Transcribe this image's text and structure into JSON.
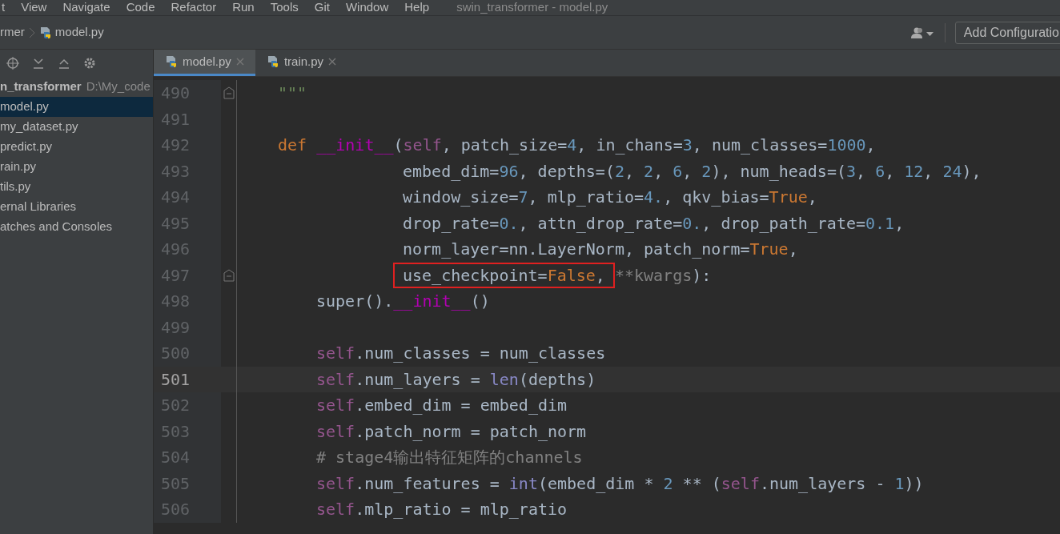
{
  "menu_bar": {
    "items": [
      "t",
      "View",
      "Navigate",
      "Code",
      "Refactor",
      "Run",
      "Tools",
      "Git",
      "Window",
      "Help"
    ],
    "title": "swin_transformer - model.py"
  },
  "nav_bar": {
    "breadcrumb": [
      "rmer",
      "model.py"
    ],
    "run_config": "Add Configuratio"
  },
  "tabs": [
    {
      "label": "model.py",
      "selected": true
    },
    {
      "label": "train.py",
      "selected": false
    }
  ],
  "project_tree": {
    "root": {
      "name": "n_transformer",
      "path": "D:\\My_code"
    },
    "items": [
      {
        "label": "model.py",
        "selected": true
      },
      {
        "label": "my_dataset.py",
        "selected": false
      },
      {
        "label": "predict.py",
        "selected": false
      },
      {
        "label": "rain.py",
        "selected": false
      },
      {
        "label": "tils.py",
        "selected": false
      },
      {
        "label": "ernal Libraries",
        "selected": false
      },
      {
        "label": "atches and Consoles",
        "selected": false
      }
    ]
  },
  "editor": {
    "lines": [
      {
        "number": "490",
        "current": false,
        "fold": true,
        "kind": "block",
        "tokens": [
          {
            "kind": "string",
            "text": "\"\"\""
          }
        ]
      },
      {
        "number": "491",
        "current": false,
        "fold": false
      },
      {
        "number": "492",
        "current": false,
        "fold": false,
        "kind": "block",
        "tokens": [
          {
            "kind": "keyword",
            "text": "def "
          },
          {
            "kind": "magic",
            "text": "__init__"
          },
          {
            "kind": "plain",
            "text": "("
          },
          {
            "kind": "self",
            "text": "self"
          },
          {
            "kind": "plain",
            "text": ", patch_size="
          },
          {
            "kind": "number",
            "text": "4"
          },
          {
            "kind": "plain",
            "text": ", in_chans="
          },
          {
            "kind": "number",
            "text": "3"
          },
          {
            "kind": "plain",
            "text": ", num_classes="
          },
          {
            "kind": "number",
            "text": "1000"
          },
          {
            "kind": "plain",
            "text": ","
          }
        ]
      },
      {
        "number": "493",
        "current": false,
        "fold": false,
        "kind": "continuation",
        "tokens": [
          {
            "kind": "plain",
            "text": "embed_dim="
          },
          {
            "kind": "number",
            "text": "96"
          },
          {
            "kind": "plain",
            "text": ", depths=("
          },
          {
            "kind": "number",
            "text": "2"
          },
          {
            "kind": "plain",
            "text": ", "
          },
          {
            "kind": "number",
            "text": "2"
          },
          {
            "kind": "plain",
            "text": ", "
          },
          {
            "kind": "number",
            "text": "6"
          },
          {
            "kind": "plain",
            "text": ", "
          },
          {
            "kind": "number",
            "text": "2"
          },
          {
            "kind": "plain",
            "text": "), num_heads=("
          },
          {
            "kind": "number",
            "text": "3"
          },
          {
            "kind": "plain",
            "text": ", "
          },
          {
            "kind": "number",
            "text": "6"
          },
          {
            "kind": "plain",
            "text": ", "
          },
          {
            "kind": "number",
            "text": "12"
          },
          {
            "kind": "plain",
            "text": ", "
          },
          {
            "kind": "number",
            "text": "24"
          },
          {
            "kind": "plain",
            "text": "),"
          }
        ]
      },
      {
        "number": "494",
        "current": false,
        "fold": false,
        "kind": "continuation",
        "tokens": [
          {
            "kind": "plain",
            "text": "window_size="
          },
          {
            "kind": "number",
            "text": "7"
          },
          {
            "kind": "plain",
            "text": ", mlp_ratio="
          },
          {
            "kind": "number",
            "text": "4."
          },
          {
            "kind": "plain",
            "text": ", qkv_bias="
          },
          {
            "kind": "keyword",
            "text": "True"
          },
          {
            "kind": "plain",
            "text": ","
          }
        ]
      },
      {
        "number": "495",
        "current": false,
        "fold": false,
        "kind": "continuation",
        "tokens": [
          {
            "kind": "plain",
            "text": "drop_rate="
          },
          {
            "kind": "number",
            "text": "0."
          },
          {
            "kind": "plain",
            "text": ", attn_drop_rate="
          },
          {
            "kind": "number",
            "text": "0."
          },
          {
            "kind": "plain",
            "text": ", drop_path_rate="
          },
          {
            "kind": "number",
            "text": "0.1"
          },
          {
            "kind": "plain",
            "text": ","
          }
        ]
      },
      {
        "number": "496",
        "current": false,
        "fold": false,
        "kind": "continuation",
        "tokens": [
          {
            "kind": "plain",
            "text": "norm_layer=nn.LayerNorm, patch_norm="
          },
          {
            "kind": "keyword",
            "text": "True"
          },
          {
            "kind": "plain",
            "text": ","
          }
        ]
      },
      {
        "number": "497",
        "current": false,
        "fold": true,
        "kind": "continuation",
        "tokens": [
          {
            "kind": "box",
            "tokens": [
              {
                "kind": "plain",
                "text": "use_checkpoint="
              },
              {
                "kind": "keyword",
                "text": "False"
              },
              {
                "kind": "plain",
                "text": ","
              }
            ]
          },
          {
            "kind": "dim",
            "text": "**kwargs"
          },
          {
            "kind": "plain",
            "text": "):"
          }
        ]
      },
      {
        "number": "498",
        "current": false,
        "fold": false,
        "kind": "body",
        "tokens": [
          {
            "kind": "plain",
            "text": "super()."
          },
          {
            "kind": "magic",
            "text": "__init__"
          },
          {
            "kind": "plain",
            "text": "()"
          }
        ]
      },
      {
        "number": "499",
        "current": false,
        "fold": false
      },
      {
        "number": "500",
        "current": false,
        "fold": false,
        "kind": "body",
        "tokens": [
          {
            "kind": "self",
            "text": "self"
          },
          {
            "kind": "plain",
            "text": ".num_classes = num_classes"
          }
        ]
      },
      {
        "number": "501",
        "current": true,
        "fold": false,
        "kind": "body",
        "tokens": [
          {
            "kind": "self",
            "text": "self"
          },
          {
            "kind": "plain",
            "text": ".num_layers = "
          },
          {
            "kind": "builtin",
            "text": "len"
          },
          {
            "kind": "plain",
            "text": "(depths)"
          }
        ]
      },
      {
        "number": "502",
        "current": false,
        "fold": false,
        "kind": "body",
        "tokens": [
          {
            "kind": "self",
            "text": "self"
          },
          {
            "kind": "plain",
            "text": ".embed_dim = embed_dim"
          }
        ]
      },
      {
        "number": "503",
        "current": false,
        "fold": false,
        "kind": "body",
        "tokens": [
          {
            "kind": "self",
            "text": "self"
          },
          {
            "kind": "plain",
            "text": ".patch_norm = patch_norm"
          }
        ]
      },
      {
        "number": "504",
        "current": false,
        "fold": false,
        "kind": "body",
        "tokens": [
          {
            "kind": "comment",
            "text": "# stage4输出特征矩阵的channels"
          }
        ]
      },
      {
        "number": "505",
        "current": false,
        "fold": false,
        "kind": "body",
        "tokens": [
          {
            "kind": "self",
            "text": "self"
          },
          {
            "kind": "plain",
            "text": ".num_features = "
          },
          {
            "kind": "builtin",
            "text": "int"
          },
          {
            "kind": "plain",
            "text": "(embed_dim * "
          },
          {
            "kind": "number",
            "text": "2"
          },
          {
            "kind": "plain",
            "text": " ** ("
          },
          {
            "kind": "self",
            "text": "self"
          },
          {
            "kind": "plain",
            "text": ".num_layers - "
          },
          {
            "kind": "number",
            "text": "1"
          },
          {
            "kind": "plain",
            "text": "))"
          }
        ]
      },
      {
        "number": "506",
        "current": false,
        "fold": false,
        "kind": "body",
        "tokens": [
          {
            "kind": "self",
            "text": "self"
          },
          {
            "kind": "plain",
            "text": ".mlp_ratio = mlp_ratio"
          }
        ]
      }
    ]
  }
}
